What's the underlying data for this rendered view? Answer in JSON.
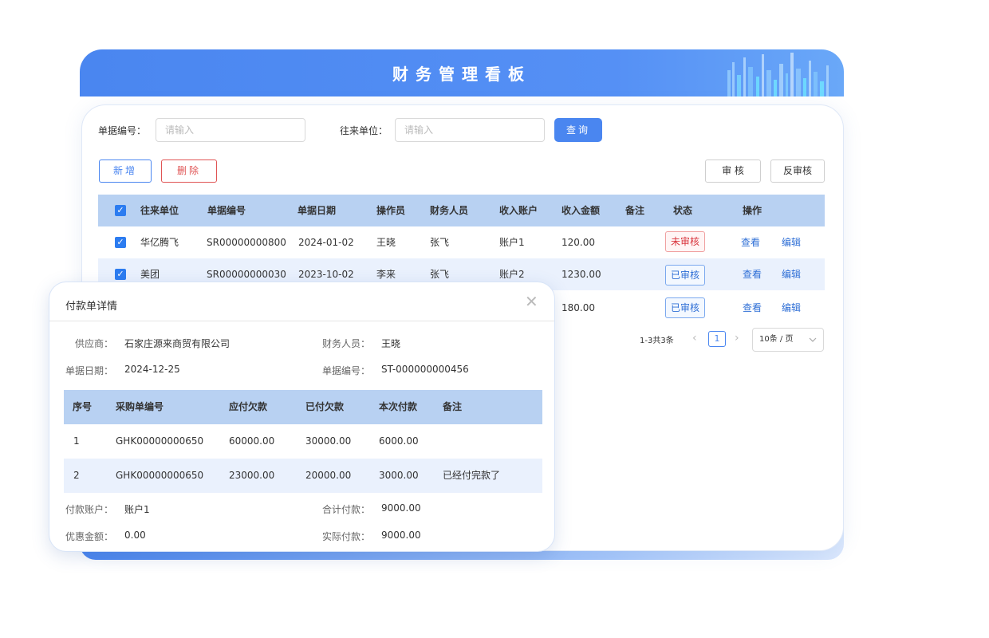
{
  "header": {
    "title": "财务管理看板"
  },
  "filters": {
    "doc_no_label": "单据编号：",
    "doc_no_placeholder": "请输入",
    "partner_label": "往来单位：",
    "partner_placeholder": "请输入",
    "query_label": "查询"
  },
  "toolbar": {
    "add_label": "新增",
    "delete_label": "删除",
    "audit_label": "审 核",
    "unaudit_label": "反审核"
  },
  "table": {
    "columns": [
      "往来单位",
      "单据编号",
      "单据日期",
      "操作员",
      "财务人员",
      "收入账户",
      "收入金额",
      "备注",
      "状态",
      "操作"
    ],
    "rows": [
      {
        "partner": "华亿腾飞",
        "doc_no": "SR00000000800",
        "date": "2024-01-02",
        "operator": "王晓",
        "finance": "张飞",
        "account": "账户1",
        "amount": "120.00",
        "remark": "",
        "status": "未审核",
        "view": "查看",
        "edit": "编辑"
      },
      {
        "partner": "美团",
        "doc_no": "SR00000000030",
        "date": "2023-10-02",
        "operator": "李来",
        "finance": "张飞",
        "account": "账户2",
        "amount": "1230.00",
        "remark": "",
        "status": "已审核",
        "view": "查看",
        "edit": "编辑"
      },
      {
        "partner": "",
        "doc_no": "",
        "date": "",
        "operator": "",
        "finance": "",
        "account": "",
        "amount": "180.00",
        "remark": "",
        "status": "已审核",
        "view": "查看",
        "edit": "编辑"
      }
    ]
  },
  "pagination": {
    "summary": "1-3共3条",
    "current_page": "1",
    "page_size": "10条 / 页"
  },
  "modal": {
    "title": "付款单详情",
    "supplier_label": "供应商：",
    "supplier": "石家庄源来商贸有限公司",
    "finance_label": "财务人员：",
    "finance": "王晓",
    "date_label": "单据日期：",
    "date": "2024-12-25",
    "doc_no_label": "单据编号：",
    "doc_no": "ST-000000000456",
    "columns": [
      "序号",
      "采购单编号",
      "应付欠款",
      "已付欠款",
      "本次付款",
      "备注"
    ],
    "rows": [
      {
        "no": "1",
        "po": "GHK00000000650",
        "payable": "60000.00",
        "paid": "30000.00",
        "current": "6000.00",
        "remark": ""
      },
      {
        "no": "2",
        "po": "GHK00000000650",
        "payable": "23000.00",
        "paid": "20000.00",
        "current": "3000.00",
        "remark": "已经付完款了"
      }
    ],
    "account_label": "付款账户：",
    "account": "账户1",
    "total_label": "合计付款：",
    "total": "9000.00",
    "discount_label": "优惠金额：",
    "discount": "0.00",
    "actual_label": "实际付款：",
    "actual": "9000.00"
  }
}
